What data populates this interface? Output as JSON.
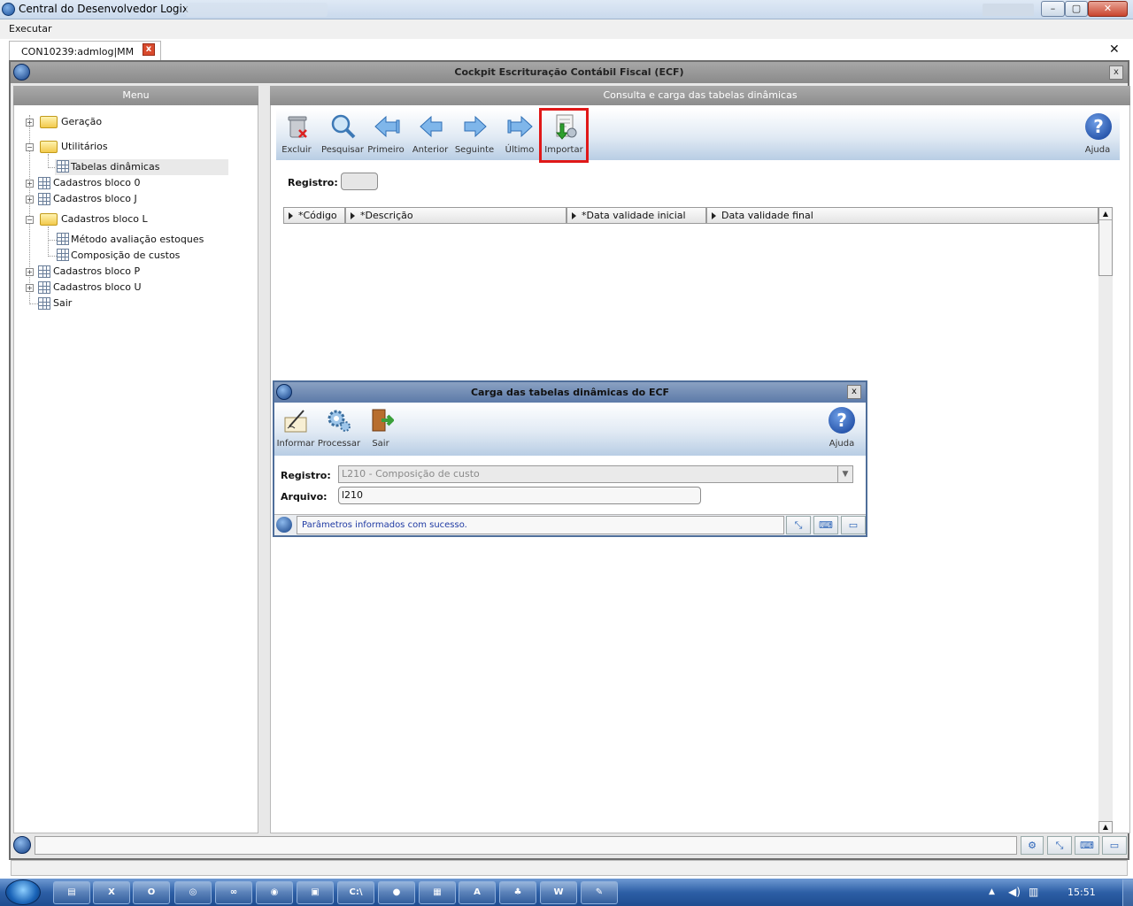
{
  "window": {
    "title": "Central do Desenvolvedor Logix",
    "minimize": "–",
    "maximize": "▢",
    "close": "✕"
  },
  "menubar": {
    "executar": "Executar"
  },
  "doc_tab": {
    "label": "CON10239:admlog|MM",
    "close": "x"
  },
  "global_close": "✕",
  "frame": {
    "title": "Cockpit Escrituração Contábil Fiscal (ECF)",
    "close": "x"
  },
  "menu": {
    "title": "Menu",
    "items": [
      {
        "label": "Geração"
      },
      {
        "label": "Utilitários"
      },
      {
        "label": "Tabelas dinâmicas"
      },
      {
        "label": "Cadastros bloco 0"
      },
      {
        "label": "Cadastros bloco J"
      },
      {
        "label": "Cadastros bloco L"
      },
      {
        "label": "Método avaliação estoques"
      },
      {
        "label": "Composição de custos"
      },
      {
        "label": "Cadastros bloco P"
      },
      {
        "label": "Cadastros bloco U"
      },
      {
        "label": "Sair"
      }
    ]
  },
  "panel": {
    "title": "Consulta e carga das tabelas dinâmicas",
    "toolbar": {
      "excluir": "Excluir",
      "pesquisar": "Pesquisar",
      "primeiro": "Primeiro",
      "anterior": "Anterior",
      "seguinte": "Seguinte",
      "ultimo": "Último",
      "importar": "Importar",
      "ajuda": "Ajuda"
    },
    "registro_label": "Registro:",
    "registro_value": "",
    "grid": {
      "columns": [
        "*Código",
        "*Descrição",
        "*Data validade inicial",
        "Data validade final"
      ]
    }
  },
  "dialog": {
    "title": "Carga das tabelas dinâmicas do ECF",
    "close": "x",
    "toolbar": {
      "informar": "Informar",
      "processar": "Processar",
      "sair": "Sair",
      "ajuda": "Ajuda"
    },
    "registro_label": "Registro:",
    "registro_value": "L210 - Composição de custo",
    "arquivo_label": "Arquivo:",
    "arquivo_value": "l210",
    "status_message": "Parâmetros informados com sucesso."
  },
  "taskbar": {
    "clock": "15:51"
  },
  "colors": {
    "highlight": "#e01818",
    "status_text": "#1f3aa3"
  }
}
